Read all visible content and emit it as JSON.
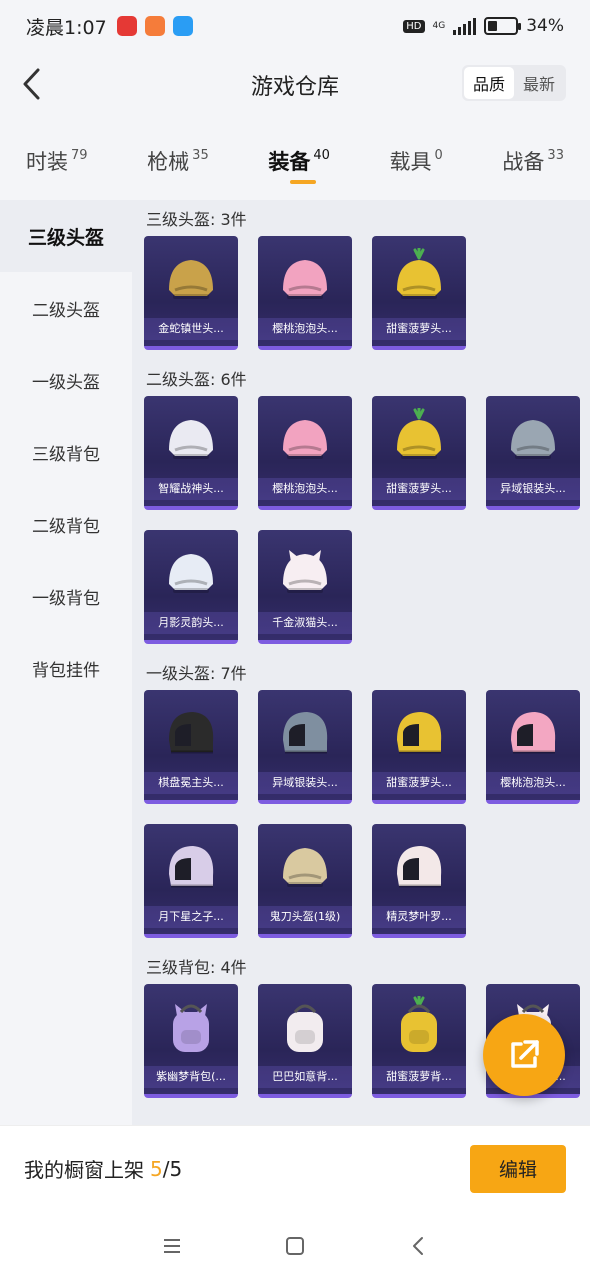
{
  "status": {
    "time": "凌晨1:07",
    "hd": "HD",
    "network": "4G",
    "battery_text": "34%",
    "battery_level": 0.34
  },
  "header": {
    "title": "游戏仓库",
    "sort_options": [
      "品质",
      "最新"
    ],
    "sort_active": 0
  },
  "tabs": [
    {
      "label": "时装",
      "count": "79"
    },
    {
      "label": "枪械",
      "count": "35"
    },
    {
      "label": "装备",
      "count": "40",
      "active": true
    },
    {
      "label": "载具",
      "count": "0"
    },
    {
      "label": "战备",
      "count": "33"
    }
  ],
  "sidebar": {
    "items": [
      "三级头盔",
      "二级头盔",
      "一级头盔",
      "三级背包",
      "二级背包",
      "一级背包",
      "背包挂件"
    ],
    "active": 0
  },
  "sections": [
    {
      "title": "三级头盔: 3件",
      "items": [
        {
          "name": "金蛇镇世头...",
          "icon": "gold-helmet-icon",
          "color": "#c9a24a"
        },
        {
          "name": "樱桃泡泡头...",
          "icon": "pink-helmet-icon",
          "color": "#f2a3c0"
        },
        {
          "name": "甜蜜菠萝头...",
          "icon": "pineapple-helmet-icon",
          "color": "#e8c232"
        }
      ]
    },
    {
      "title": "二级头盔: 6件",
      "items": [
        {
          "name": "智耀战神头...",
          "icon": "white-helmet-icon",
          "color": "#eaeaf2"
        },
        {
          "name": "樱桃泡泡头...",
          "icon": "pink-helmet-icon",
          "color": "#f2a3c0"
        },
        {
          "name": "甜蜜菠萝头...",
          "icon": "pineapple-helmet-icon",
          "color": "#e8c232"
        },
        {
          "name": "异域银装头...",
          "icon": "silver-helmet-icon",
          "color": "#9aa6b2"
        },
        {
          "name": "月影灵韵头...",
          "icon": "white-helmet-icon",
          "color": "#e7ecf5"
        },
        {
          "name": "千金淑猫头...",
          "icon": "cat-helmet-icon",
          "color": "#f7eef2"
        }
      ]
    },
    {
      "title": "一级头盔: 7件",
      "items": [
        {
          "name": "棋盘冕主头...",
          "icon": "moto-helmet-icon",
          "color": "#2b2b2b"
        },
        {
          "name": "异域银装头...",
          "icon": "moto-helmet-icon",
          "color": "#7f8fa0"
        },
        {
          "name": "甜蜜菠萝头...",
          "icon": "moto-helmet-icon",
          "color": "#e8c232"
        },
        {
          "name": "樱桃泡泡头...",
          "icon": "moto-helmet-icon",
          "color": "#f3a7c2"
        },
        {
          "name": "月下星之子...",
          "icon": "moto-helmet-icon",
          "color": "#d8cde8"
        },
        {
          "name": "鬼刀头盔(1级)",
          "icon": "knight-helmet-icon",
          "color": "#d9c9a0"
        },
        {
          "name": "精灵梦叶罗...",
          "icon": "moto-helmet-icon",
          "color": "#f3e8e8"
        }
      ]
    },
    {
      "title": "三级背包: 4件",
      "items": [
        {
          "name": "紫幽梦背包(...",
          "icon": "bunny-backpack-icon",
          "color": "#b8a2e6"
        },
        {
          "name": "巴巴如意背...",
          "icon": "white-backpack-icon",
          "color": "#f2ecef"
        },
        {
          "name": "甜蜜菠萝背...",
          "icon": "pineapple-backpack-icon",
          "color": "#e8c232"
        },
        {
          "name": "千金淑猫背...",
          "icon": "cat-backpack-icon",
          "color": "#f7eef2"
        }
      ]
    }
  ],
  "fab": {
    "icon": "share-out-icon"
  },
  "showcase": {
    "label": "我的橱窗上架",
    "current": "5",
    "separator": "/",
    "total": "5",
    "edit_label": "编辑"
  },
  "navbar": {
    "icons": [
      "menu-icon",
      "home-icon",
      "back-icon"
    ]
  }
}
